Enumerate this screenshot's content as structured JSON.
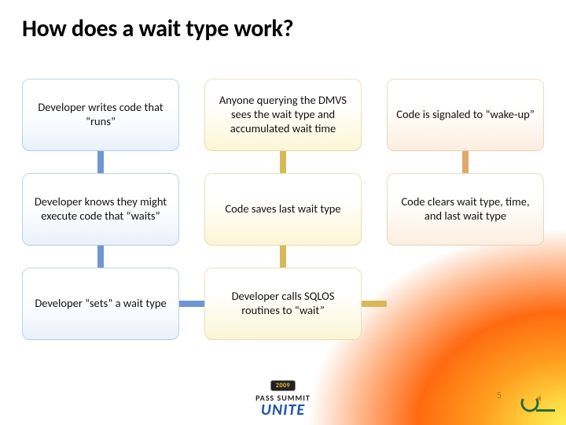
{
  "title": "How does a wait type work?",
  "cells": {
    "r0c0": "Developer writes code that “runs”",
    "r0c1": "Anyone querying the DMVS sees the wait type and accumulated wait time",
    "r0c2": "Code is signaled to “wake-up”",
    "r1c0": "Developer knows they might execute code that “waits”",
    "r1c1": "Code saves last wait type",
    "r1c2": "Code clears wait type, time, and last wait type",
    "r2c0": "Developer “sets” a wait type",
    "r2c1": "Developer calls SQLOS routines to “wait”"
  },
  "footer": {
    "year": "2009",
    "line1": "PASS SUMMIT",
    "line2": "UNITE"
  },
  "page_number": "5"
}
